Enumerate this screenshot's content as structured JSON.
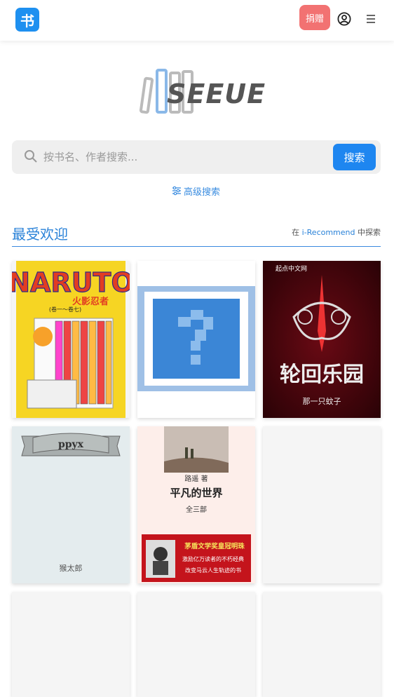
{
  "header": {
    "logo_char": "书",
    "donate_label": "捐赠",
    "icons": [
      "user-circle-icon",
      "menu-icon"
    ]
  },
  "brand": {
    "name": "SEEUE"
  },
  "search": {
    "placeholder": "按书名、作者搜索...",
    "button_label": "搜索",
    "advanced_label": "高级搜索"
  },
  "popular": {
    "title": "最受欢迎",
    "explore_prefix": "在",
    "explore_link": "i-Recommend",
    "explore_suffix": "中探索"
  },
  "books": [
    {
      "title": "NARUTO",
      "subtitle": "火影忍者",
      "volumes": "(卷一～卷七)"
    },
    {
      "title": ""
    },
    {
      "title": "轮回乐园",
      "publisher": "起点中文网",
      "author": "那一只蚊子"
    },
    {
      "title": "ppyx",
      "author": "猴太郎"
    },
    {
      "title": "平凡的世界",
      "author_line": "路遥 著",
      "edition": "全三部",
      "blurb": [
        "茅盾文学奖皇冠明珠",
        "激励亿万读者的不朽经典",
        "改变马云人生轨迹的书"
      ]
    },
    {
      "title": ""
    },
    {
      "title": ""
    },
    {
      "title": ""
    },
    {
      "title": ""
    }
  ],
  "colors": {
    "accent": "#1e86f0",
    "donate": "#f27272",
    "link": "#2a82d8"
  }
}
